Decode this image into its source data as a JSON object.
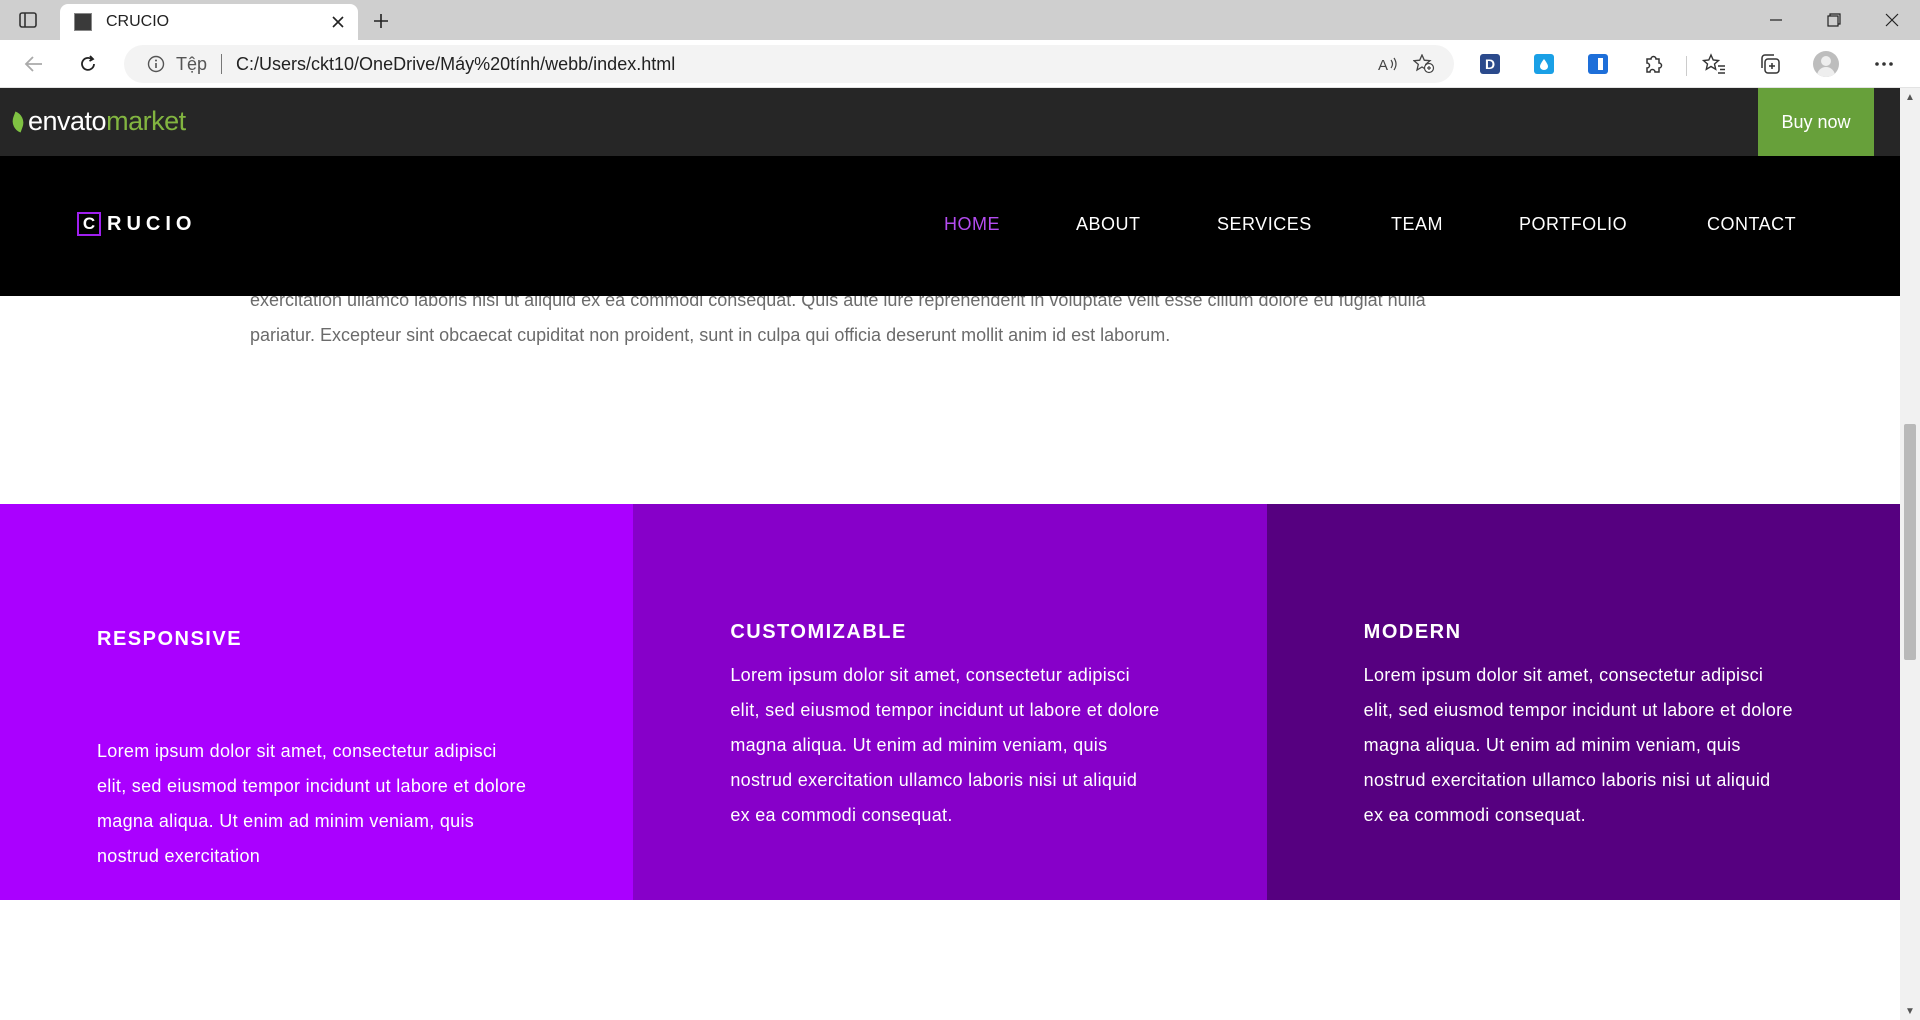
{
  "browser": {
    "tab_title": "CRUCIO",
    "site_label": "Tệp",
    "url": "C:/Users/ckt10/OneDrive/Máy%20tính/webb/index.html",
    "extensions": [
      {
        "name": "D",
        "color": "#2b4a8c"
      },
      {
        "name": "",
        "color": "#1aa0e6"
      },
      {
        "name": "",
        "color": "#1e6fd9"
      }
    ]
  },
  "envato": {
    "logo_envato": "envato",
    "logo_market": "market",
    "buy_now": "Buy now"
  },
  "intro": {
    "line1": "exercitation ullamco laboris nisi ut aliquid ex ea commodi consequat. Quis aute iure reprehenderit in voluptate velit esse cillum dolore eu fugiat nulla",
    "line2": "pariatur. Excepteur sint obcaecat cupiditat non proident, sunt in culpa qui officia deserunt mollit anim id est laborum."
  },
  "header": {
    "logo_letter": "C",
    "logo_rest": "RUCIO",
    "nav": [
      {
        "label": "HOME",
        "active": true
      },
      {
        "label": "ABOUT",
        "active": false
      },
      {
        "label": "SERVICES",
        "active": false
      },
      {
        "label": "TEAM",
        "active": false
      },
      {
        "label": "PORTFOLIO",
        "active": false
      },
      {
        "label": "CONTACT",
        "active": false
      }
    ]
  },
  "colors": {
    "accent": "#b44cf0",
    "feature1": "#aa00ff",
    "feature2": "#8700c9",
    "feature3": "#560080",
    "envato_green": "#67a03a"
  },
  "features": [
    {
      "title": "RESPONSIVE",
      "text": "Lorem ipsum dolor sit amet, consectetur adipisci elit, sed eiusmod tempor incidunt ut labore et dolore magna aliqua. Ut enim ad minim veniam, quis nostrud exercitation"
    },
    {
      "title": "CUSTOMIZABLE",
      "text": "Lorem ipsum dolor sit amet, consectetur adipisci elit, sed eiusmod tempor incidunt ut labore et dolore magna aliqua. Ut enim ad minim veniam, quis nostrud exercitation ullamco laboris nisi ut aliquid ex ea commodi consequat."
    },
    {
      "title": "MODERN",
      "text": "Lorem ipsum dolor sit amet, consectetur adipisci elit, sed eiusmod tempor incidunt ut labore et dolore magna aliqua. Ut enim ad minim veniam, quis nostrud exercitation ullamco laboris nisi ut aliquid ex ea commodi consequat."
    }
  ]
}
